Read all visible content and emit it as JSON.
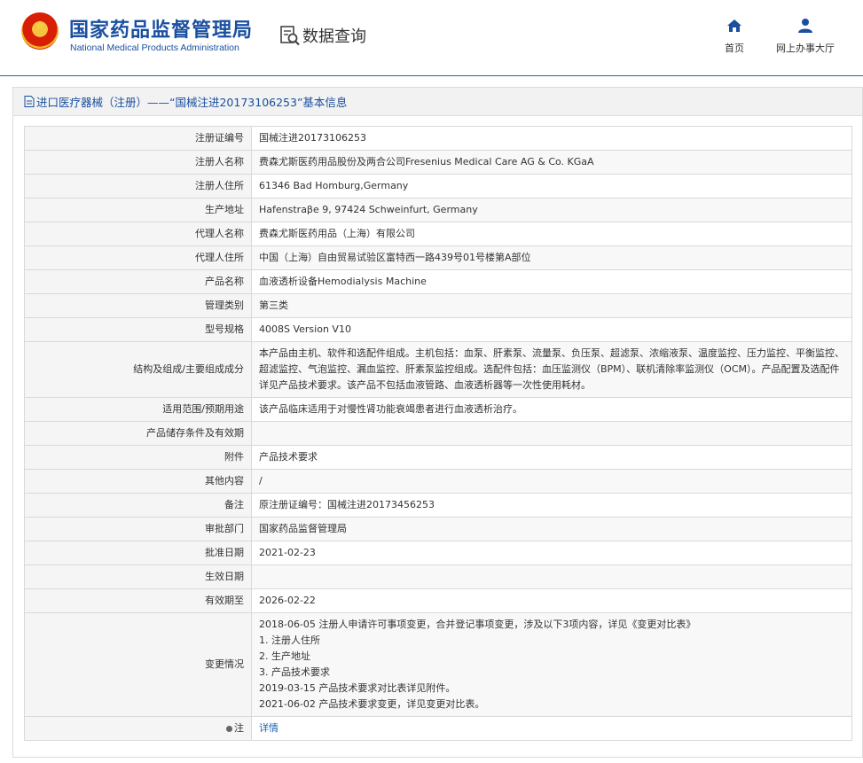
{
  "header": {
    "org_name_cn": "国家药品监督管理局",
    "org_name_en": "National Medical Products Administration",
    "query_label": "数据查询",
    "nav": [
      {
        "label": "首页",
        "icon": "home-icon"
      },
      {
        "label": "网上办事大厅",
        "icon": "user-icon"
      }
    ]
  },
  "panel": {
    "title": "进口医疗器械（注册）——“国械注进20173106253”基本信息"
  },
  "rows": [
    {
      "key": "注册证编号",
      "value": "国械注进20173106253"
    },
    {
      "key": "注册人名称",
      "value": "费森尤斯医药用品股份及两合公司Fresenius Medical Care AG & Co. KGaA"
    },
    {
      "key": "注册人住所",
      "value": "61346 Bad Homburg,Germany"
    },
    {
      "key": "生产地址",
      "value": "Hafenstraβe 9, 97424 Schweinfurt, Germany"
    },
    {
      "key": "代理人名称",
      "value": "费森尤斯医药用品（上海）有限公司"
    },
    {
      "key": "代理人住所",
      "value": "中国（上海）自由贸易试验区富特西一路439号01号楼第A部位"
    },
    {
      "key": "产品名称",
      "value": "血液透析设备Hemodialysis Machine"
    },
    {
      "key": "管理类别",
      "value": "第三类"
    },
    {
      "key": "型号规格",
      "value": "4008S Version V10"
    },
    {
      "key": "结构及组成/主要组成成分",
      "value": "本产品由主机、软件和选配件组成。主机包括：血泵、肝素泵、流量泵、负压泵、超滤泵、浓缩液泵、温度监控、压力监控、平衡监控、超滤监控、气泡监控、漏血监控、肝素泵监控组成。选配件包括：血压监测仪（BPM）、联机清除率监测仪（OCM）。产品配置及选配件详见产品技术要求。该产品不包括血液管路、血液透析器等一次性使用耗材。"
    },
    {
      "key": "适用范围/预期用途",
      "value": "该产品临床适用于对慢性肾功能衰竭患者进行血液透析治疗。"
    },
    {
      "key": "产品储存条件及有效期",
      "value": ""
    },
    {
      "key": "附件",
      "value": "产品技术要求"
    },
    {
      "key": "其他内容",
      "value": "/"
    },
    {
      "key": "备注",
      "value": "原注册证编号：国械注进20173456253"
    },
    {
      "key": "审批部门",
      "value": "国家药品监督管理局"
    },
    {
      "key": "批准日期",
      "value": "2021-02-23"
    },
    {
      "key": "生效日期",
      "value": ""
    },
    {
      "key": "有效期至",
      "value": "2026-02-22"
    }
  ],
  "change_row": {
    "key": "变更情况",
    "lines": [
      "2018-06-05 注册人申请许可事项变更，合并登记事项变更，涉及以下3项内容，详见《变更对比表》",
      "1. 注册人住所",
      "2. 生产地址",
      "3. 产品技术要求",
      "2019-03-15 产品技术要求对比表详见附件。",
      "2021-06-02 产品技术要求变更，详见变更对比表。"
    ]
  },
  "note_row": {
    "key": "注",
    "link": "详情"
  }
}
